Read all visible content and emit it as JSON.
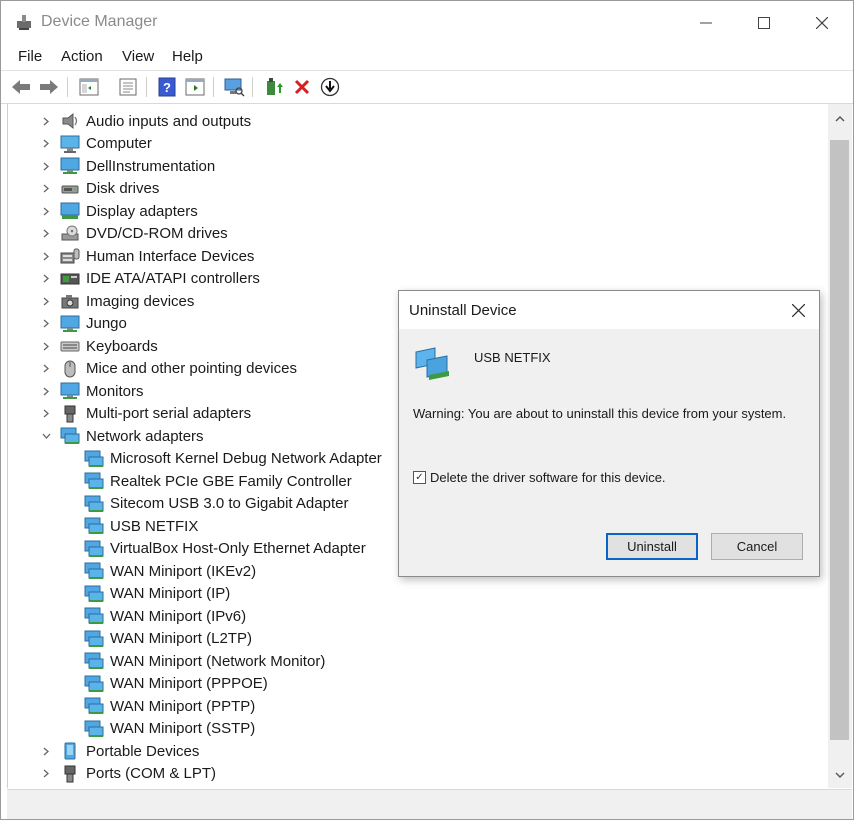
{
  "window": {
    "title": "Device Manager"
  },
  "menu": [
    "File",
    "Action",
    "View",
    "Help"
  ],
  "toolbar_icons": [
    "back-icon",
    "forward-icon",
    "show-hide-tree-icon",
    "properties-icon",
    "help-icon",
    "run-icon",
    "scan-hardware-icon",
    "update-driver-icon",
    "uninstall-icon",
    "download-icon"
  ],
  "tree": {
    "categories_top": [
      {
        "label": "Audio inputs and outputs",
        "icon": "speaker-icon"
      },
      {
        "label": "Computer",
        "icon": "computer-icon"
      },
      {
        "label": "DellInstrumentation",
        "icon": "monitor-icon"
      },
      {
        "label": "Disk drives",
        "icon": "disk-drive-icon"
      },
      {
        "label": "Display adapters",
        "icon": "display-adapter-icon"
      },
      {
        "label": "DVD/CD-ROM drives",
        "icon": "dvd-drive-icon"
      },
      {
        "label": "Human Interface Devices",
        "icon": "hid-icon"
      },
      {
        "label": "IDE ATA/ATAPI controllers",
        "icon": "ide-controller-icon"
      },
      {
        "label": "Imaging devices",
        "icon": "camera-icon"
      },
      {
        "label": "Jungo",
        "icon": "monitor-icon"
      },
      {
        "label": "Keyboards",
        "icon": "keyboard-icon"
      },
      {
        "label": "Mice and other pointing devices",
        "icon": "mouse-icon"
      },
      {
        "label": "Monitors",
        "icon": "monitor-icon"
      },
      {
        "label": "Multi-port serial adapters",
        "icon": "serial-port-icon"
      }
    ],
    "network": {
      "label": "Network adapters",
      "children": [
        "Microsoft Kernel Debug Network Adapter",
        "Realtek PCIe GBE Family Controller",
        "Sitecom USB 3.0 to Gigabit Adapter",
        "USB NETFIX",
        "VirtualBox Host-Only Ethernet Adapter",
        "WAN Miniport (IKEv2)",
        "WAN Miniport (IP)",
        "WAN Miniport (IPv6)",
        "WAN Miniport (L2TP)",
        "WAN Miniport (Network Monitor)",
        "WAN Miniport (PPPOE)",
        "WAN Miniport (PPTP)",
        "WAN Miniport (SSTP)"
      ]
    },
    "categories_bottom": [
      {
        "label": "Portable Devices",
        "icon": "portable-device-icon"
      },
      {
        "label": "Ports (COM & LPT)",
        "icon": "port-icon"
      }
    ]
  },
  "dialog": {
    "title": "Uninstall Device",
    "device_name": "USB NETFIX",
    "warning": "Warning: You are about to uninstall this device from your system.",
    "checkbox_label": "Delete the driver software for this device.",
    "checkbox_checked": true,
    "uninstall_label": "Uninstall",
    "cancel_label": "Cancel"
  }
}
